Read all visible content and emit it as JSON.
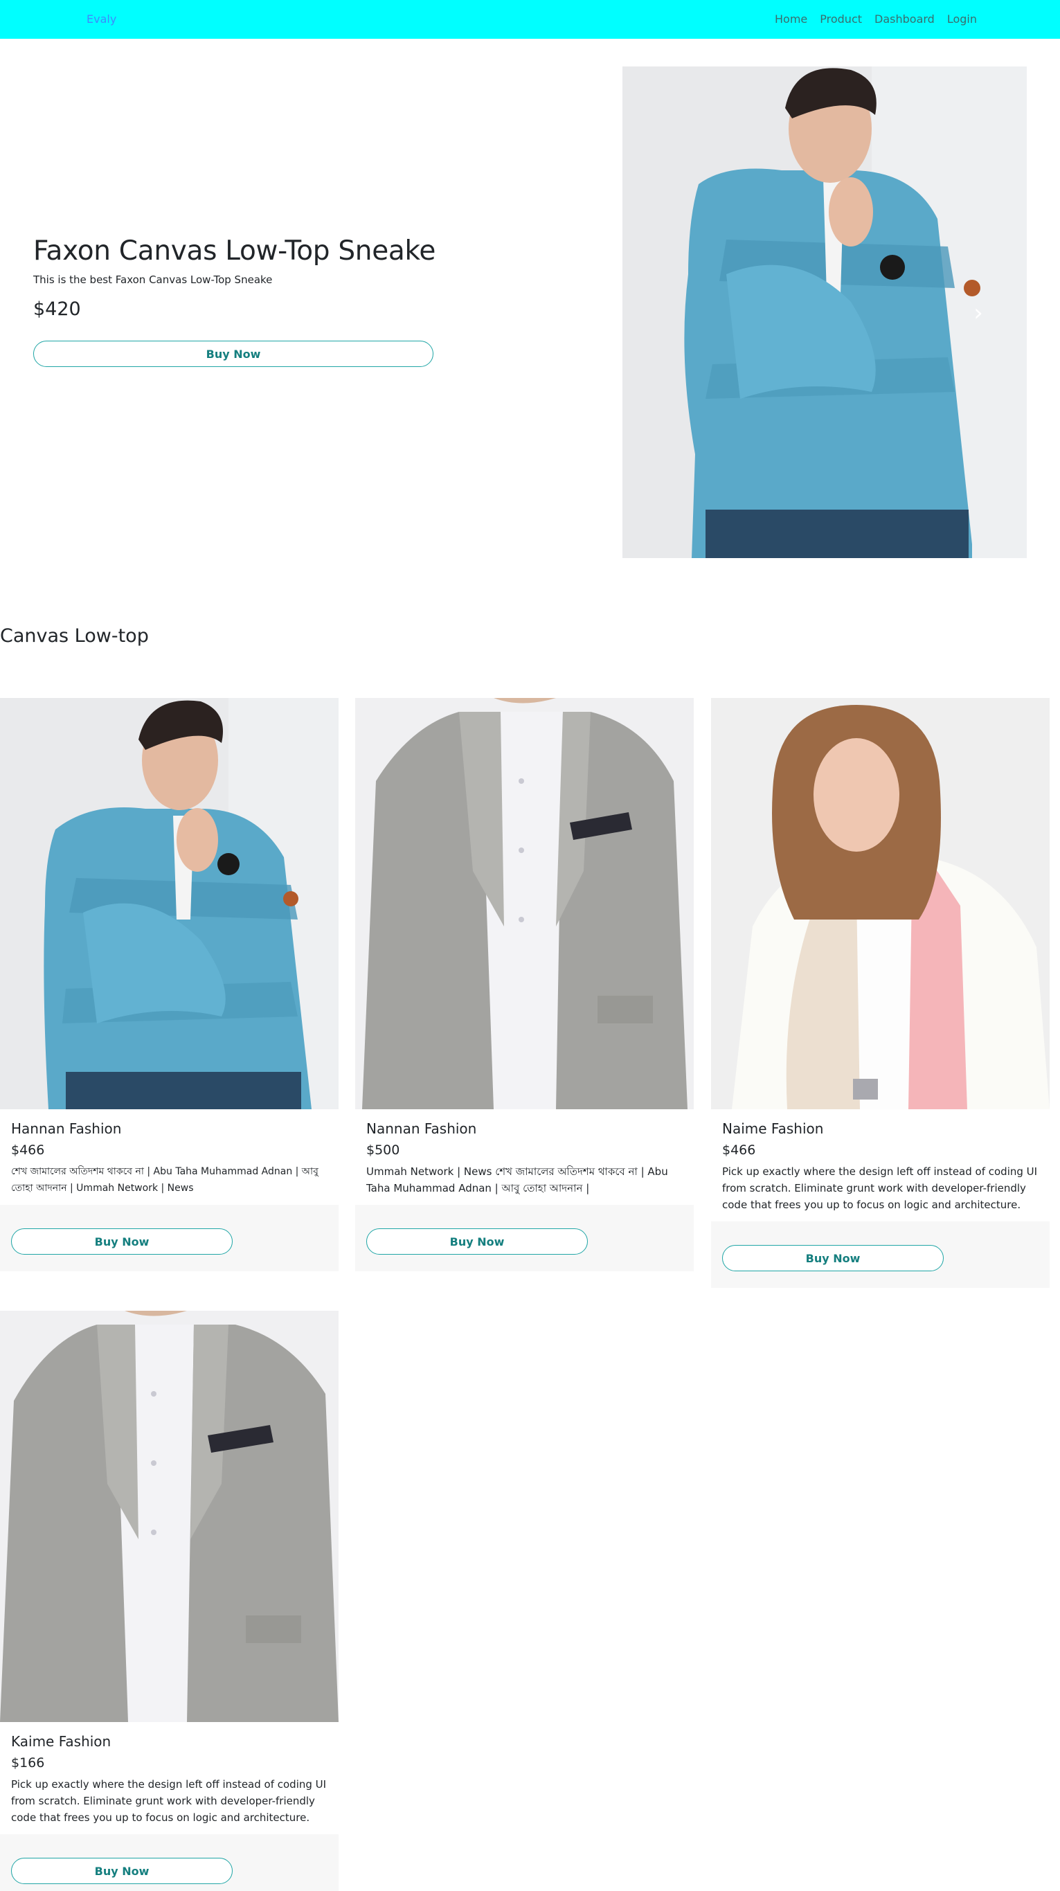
{
  "nav": {
    "brand": "Evaly",
    "links": [
      "Home",
      "Product",
      "Dashboard",
      "Login"
    ]
  },
  "hero": {
    "title": "Faxon Canvas Low-Top Sneake",
    "description": "This is the best Faxon Canvas Low-Top Sneake",
    "price": "$420",
    "button": "Buy Now",
    "next_icon": "chevron-right-icon"
  },
  "section_title": "Canvas Low-top",
  "products": [
    {
      "name": "Hannan Fashion",
      "price": "$466",
      "description": "শেখ জামালের অতিদশম থাকবে না | Abu Taha Muhammad Adnan | আবু তোহা আদনান | Ummah Network | News",
      "button": "Buy Now"
    },
    {
      "name": "Nannan Fashion",
      "price": "$500",
      "description": "Ummah Network | News শেখ জামালের অতিদশম থাকবে না | Abu Taha Muhammad Adnan | আবু তোহা আদনান |",
      "button": "Buy Now"
    },
    {
      "name": "Naime Fashion",
      "price": "$466",
      "description": "Pick up exactly where the design left off instead of coding UI from scratch. Eliminate grunt work with developer-friendly code that frees you up to focus on logic and architecture.",
      "button": "Buy Now"
    },
    {
      "name": "Kaime Fashion",
      "price": "$166",
      "description": "Pick up exactly where the design left off instead of coding UI from scratch. Eliminate grunt work with developer-friendly code that frees you up to focus on logic and architecture.",
      "button": "Buy Now"
    }
  ]
}
